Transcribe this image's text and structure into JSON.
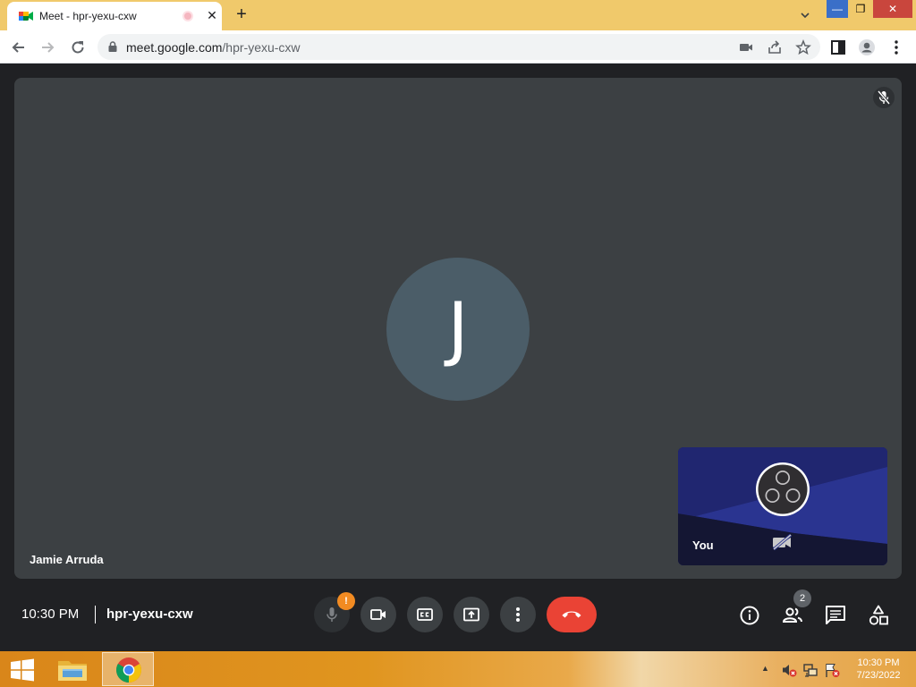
{
  "browser": {
    "tab": {
      "title": "Meet - hpr-yexu-cxw",
      "close_glyph": "✕"
    },
    "new_tab_glyph": "+",
    "omnibox": {
      "host": "meet.google.com",
      "path": "/hpr-yexu-cxw"
    },
    "window_controls": {
      "minimize": "—",
      "maximize": "❐",
      "close": "✕"
    }
  },
  "meet": {
    "main_participant": {
      "initial": "J",
      "name": "Jamie Arruda",
      "avatar_color": "#4b5d68"
    },
    "self_tile": {
      "label": "You"
    },
    "footer": {
      "time": "10:30 PM",
      "meeting_code": "hpr-yexu-cxw",
      "mic_warning_badge": "!",
      "people_count": "2"
    },
    "colors": {
      "hangup": "#ea4335",
      "tile": "#3c4043",
      "background": "#202124",
      "warning": "#f28b22"
    }
  },
  "taskbar": {
    "clock_time": "10:30 PM",
    "clock_date": "7/23/2022"
  },
  "icons": {
    "tab_favicon": "google-meet-icon",
    "toolbar": [
      "back-arrow-icon",
      "forward-arrow-icon",
      "reload-icon",
      "lock-icon",
      "camera-icon",
      "share-icon",
      "star-icon",
      "sidebar-icon",
      "profile-icon",
      "kebab-menu-icon"
    ],
    "controls": [
      "mic-off-icon",
      "camera-icon",
      "closed-captions-icon",
      "present-screen-icon",
      "more-options-icon",
      "hang-up-icon"
    ],
    "right_controls": [
      "info-icon",
      "people-icon",
      "chat-icon",
      "activities-icon"
    ]
  }
}
